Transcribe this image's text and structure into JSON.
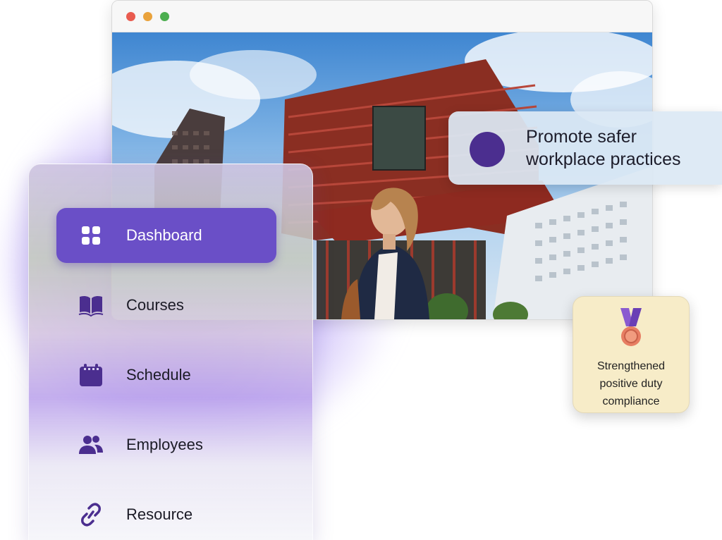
{
  "browser": {
    "window_controls": [
      "close",
      "minimize",
      "maximize"
    ]
  },
  "promo": {
    "line1": "Promote safer",
    "line2": "workplace practices",
    "dot_color": "#4b2e8f"
  },
  "badge": {
    "icon": "medal-icon",
    "line1": "Strengthened",
    "line2": "positive duty",
    "line3": "compliance"
  },
  "sidebar": {
    "accent": "#6a4fc7",
    "items": [
      {
        "label": "Dashboard",
        "icon": "grid-icon",
        "active": true
      },
      {
        "label": "Courses",
        "icon": "book-icon",
        "active": false
      },
      {
        "label": "Schedule",
        "icon": "calendar-icon",
        "active": false
      },
      {
        "label": "Employees",
        "icon": "users-icon",
        "active": false
      },
      {
        "label": "Resource",
        "icon": "link-icon",
        "active": false
      }
    ]
  }
}
